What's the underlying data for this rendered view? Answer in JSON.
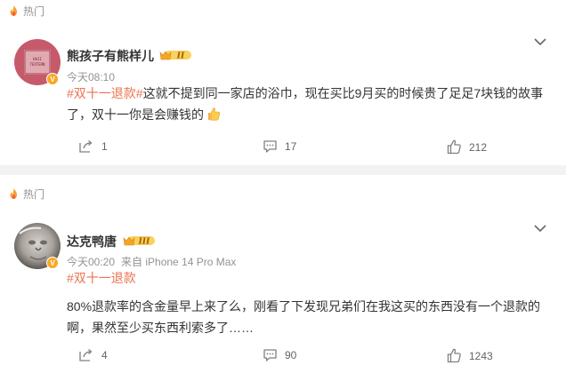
{
  "posts": [
    {
      "hot_label": "热门",
      "username": "熊孩子有熊样儿",
      "level": "II",
      "verified": "V",
      "avatar_text": "HAJI TEXTERN",
      "time": "今天08:10",
      "source": "",
      "topic": "#双十一退款#",
      "body": "这就不提到同一家店的浴巾，现在买比9月买的时候贵了足足7块钱的故事了，双十一你是会赚钱的",
      "emoji_icon": "thumbs-up-emoji",
      "reposts": "1",
      "comments": "17",
      "likes": "212"
    },
    {
      "hot_label": "热门",
      "username": "达克鸭唐",
      "level": "III",
      "verified": "V",
      "time": "今天00:20",
      "source": "来自 iPhone 14 Pro Max",
      "topic": "#双十一退款",
      "body": "80%退款率的含金量早上来了么，刚看了下发现兄弟们在我这买的东西没有一个退款的啊，果然至少买东西利索多了……",
      "reposts": "4",
      "comments": "90",
      "likes": "1243"
    }
  ],
  "colors": {
    "topic": "#eb7350",
    "meta": "#939393",
    "page_bg": "#f2f2f2",
    "badge": "#f9a825"
  }
}
